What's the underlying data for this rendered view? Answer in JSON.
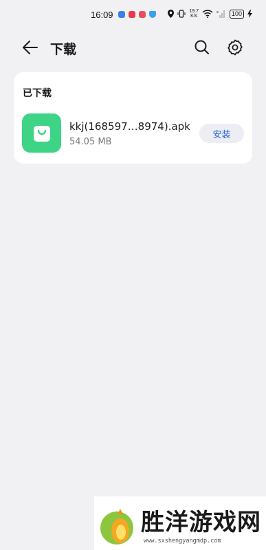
{
  "status_bar": {
    "time": "16:09",
    "speed_value": "19.7",
    "speed_unit": "K/s",
    "battery": "100"
  },
  "header": {
    "title": "下载"
  },
  "downloads": {
    "section_title": "已下载",
    "items": [
      {
        "file_name": "kkj(168597…8974).apk",
        "file_size": "54.05 MB",
        "action_label": "安装",
        "icon_color": "#3dd486"
      }
    ]
  },
  "watermark": {
    "brand": "胜洋游戏网",
    "url": "www.sxshengyangmdp.com"
  },
  "colors": {
    "background": "#f1f1f3",
    "card": "#ffffff",
    "accent": "#2a63d6",
    "app_icon": "#3dd486"
  }
}
